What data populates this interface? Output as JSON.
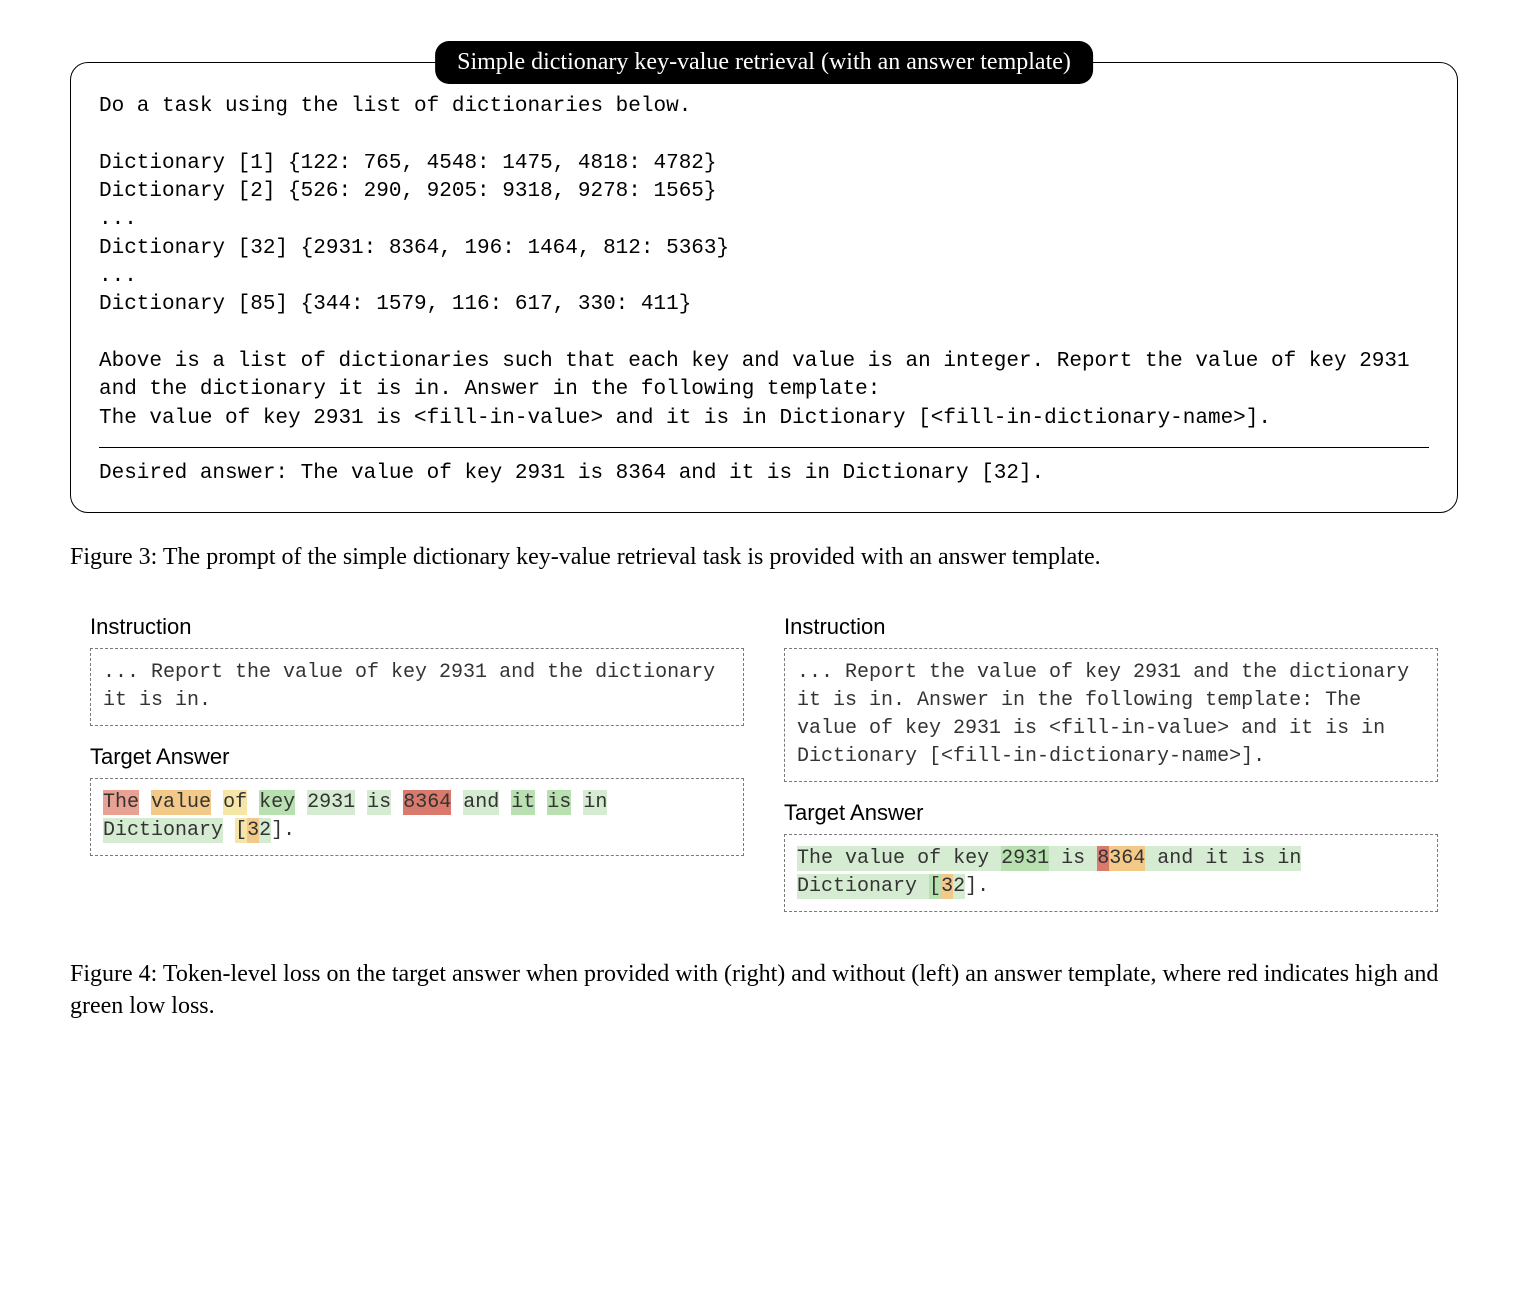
{
  "prompt": {
    "title": "Simple dictionary key-value retrieval (with an answer template)",
    "body": "Do a task using the list of dictionaries below.\n\nDictionary [1] {122: 765, 4548: 1475, 4818: 4782}\nDictionary [2] {526: 290, 9205: 9318, 9278: 1565}\n...\nDictionary [32] {2931: 8364, 196: 1464, 812: 5363}\n...\nDictionary [85] {344: 1579, 116: 617, 330: 411}\n\nAbove is a list of dictionaries such that each key and value is an integer. Report the value of key 2931 and the dictionary it is in. Answer in the following template:\nThe value of key 2931 is <fill-in-value> and it is in Dictionary [<fill-in-dictionary-name>].",
    "desired": "Desired answer: The value of key 2931 is 8364 and it is in Dictionary [32]."
  },
  "caption3": "Figure 3: The prompt of the simple dictionary key-value retrieval task is provided with an answer template.",
  "fig4": {
    "left": {
      "instr_label": "Instruction",
      "instr_text": "... Report the value of key 2931 and the dictionary it is in.",
      "target_label": "Target Answer",
      "tokens": [
        {
          "t": "The",
          "c": "r1"
        },
        {
          "t": " ",
          "c": "n"
        },
        {
          "t": "value",
          "c": "o1"
        },
        {
          "t": " ",
          "c": "n"
        },
        {
          "t": "of",
          "c": "y1"
        },
        {
          "t": " ",
          "c": "n"
        },
        {
          "t": "key",
          "c": "g2"
        },
        {
          "t": " ",
          "c": "n"
        },
        {
          "t": "2931",
          "c": "g1"
        },
        {
          "t": " ",
          "c": "n"
        },
        {
          "t": "is",
          "c": "g1"
        },
        {
          "t": " ",
          "c": "n"
        },
        {
          "t": "8364",
          "c": "r2"
        },
        {
          "t": " ",
          "c": "n"
        },
        {
          "t": "and",
          "c": "g1"
        },
        {
          "t": " ",
          "c": "n"
        },
        {
          "t": "it",
          "c": "g2"
        },
        {
          "t": " ",
          "c": "n"
        },
        {
          "t": "is",
          "c": "g2"
        },
        {
          "t": " ",
          "c": "n"
        },
        {
          "t": "in",
          "c": "g1"
        },
        {
          "t": " ",
          "c": "n"
        },
        {
          "t": "Dictionary",
          "c": "g1"
        },
        {
          "t": " ",
          "c": "n"
        },
        {
          "t": "[",
          "c": "y1"
        },
        {
          "t": "3",
          "c": "o1"
        },
        {
          "t": "2",
          "c": "g1"
        },
        {
          "t": "].",
          "c": "n"
        }
      ]
    },
    "right": {
      "instr_label": "Instruction",
      "instr_text": "... Report the value of key 2931 and the dictionary it is in. Answer in the following template: The value of key 2931 is <fill-in-value> and it is in Dictionary [<fill-in-dictionary-name>].",
      "target_label": "Target Answer",
      "tokens": [
        {
          "t": "The",
          "c": "g1"
        },
        {
          "t": " ",
          "c": "g1"
        },
        {
          "t": "value",
          "c": "g1"
        },
        {
          "t": " ",
          "c": "g1"
        },
        {
          "t": "of",
          "c": "g1"
        },
        {
          "t": " ",
          "c": "g1"
        },
        {
          "t": "key",
          "c": "g1"
        },
        {
          "t": " ",
          "c": "g1"
        },
        {
          "t": "2931",
          "c": "g2"
        },
        {
          "t": " ",
          "c": "g1"
        },
        {
          "t": "is",
          "c": "g1"
        },
        {
          "t": " ",
          "c": "g1"
        },
        {
          "t": "8",
          "c": "r2"
        },
        {
          "t": "364",
          "c": "o1"
        },
        {
          "t": " ",
          "c": "g1"
        },
        {
          "t": "and",
          "c": "g1"
        },
        {
          "t": " ",
          "c": "g1"
        },
        {
          "t": "it",
          "c": "g1"
        },
        {
          "t": " ",
          "c": "g1"
        },
        {
          "t": "is",
          "c": "g1"
        },
        {
          "t": " ",
          "c": "g1"
        },
        {
          "t": "in",
          "c": "g1"
        },
        {
          "t": " ",
          "c": "g1"
        },
        {
          "t": "Dictionary",
          "c": "g1"
        },
        {
          "t": " ",
          "c": "g1"
        },
        {
          "t": "[",
          "c": "g2"
        },
        {
          "t": "3",
          "c": "o1"
        },
        {
          "t": "2",
          "c": "g1"
        },
        {
          "t": "].",
          "c": "n"
        }
      ]
    }
  },
  "caption4": "Figure 4: Token-level loss on the target answer when provided with (right) and without (left) an answer template, where red indicates high and green low loss."
}
